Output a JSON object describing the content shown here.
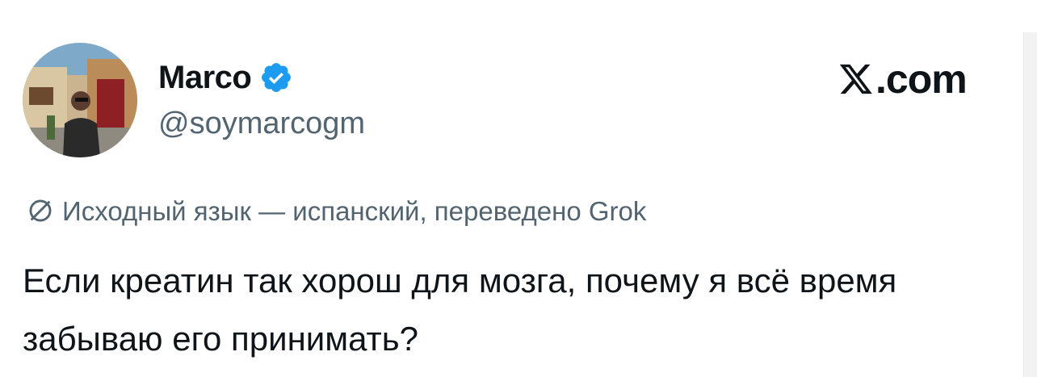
{
  "user": {
    "display_name": "Marco",
    "handle": "@soymarcogm",
    "verified": true,
    "verified_icon": "verified-badge-icon",
    "avatar_icon": "avatar-photo"
  },
  "brand": {
    "logo_icon": "x-logo-icon",
    "text": ".com"
  },
  "translation": {
    "icon": "translate-globe-icon",
    "notice": "Исходный язык — испанский, переведено Grok"
  },
  "tweet": {
    "text": "Если креатин так хорош для мозга, почему я всё время забываю его принимать?"
  },
  "colors": {
    "text_primary": "#0f1419",
    "text_secondary": "#536471",
    "verified_blue": "#1d9bf0",
    "background": "#ffffff"
  }
}
